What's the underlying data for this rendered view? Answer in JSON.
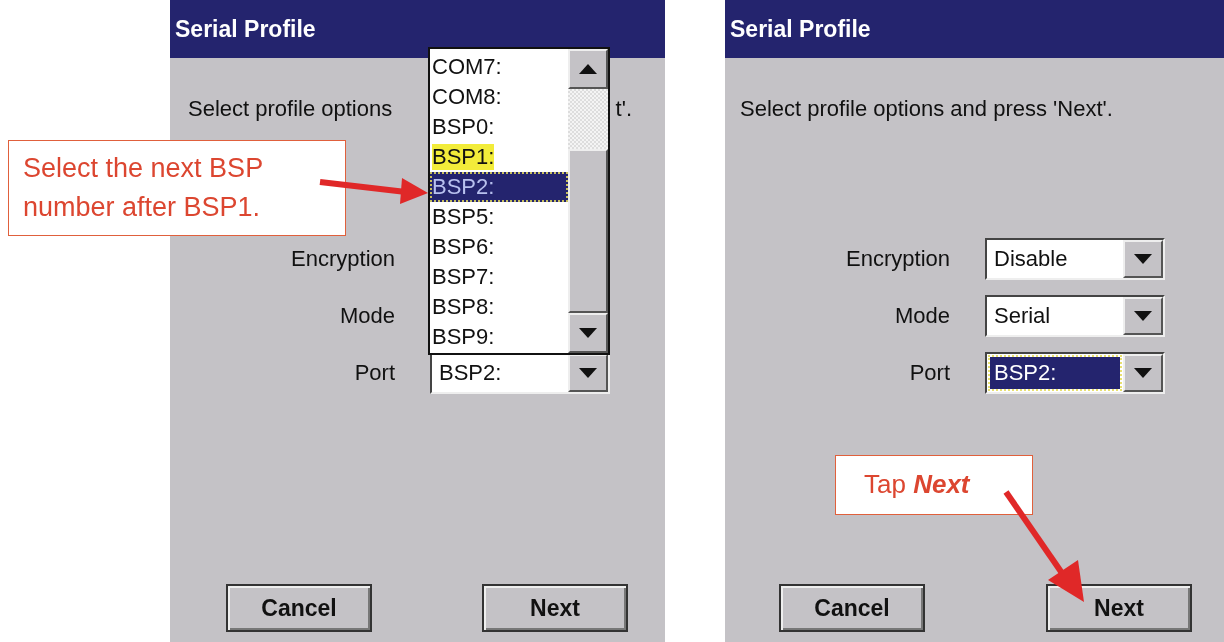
{
  "screens": [
    {
      "title": "Serial Profile",
      "instruction": [
        "Select profile options",
        "t'."
      ],
      "fields": [
        {
          "label": "Encryption"
        },
        {
          "label": "Mode"
        },
        {
          "label": "Port",
          "value": "BSP2:",
          "focused": false
        }
      ],
      "dropdown_list": {
        "items": [
          {
            "label": "COM7:",
            "selected": false,
            "highlighted": false
          },
          {
            "label": "COM8:",
            "selected": false,
            "highlighted": false
          },
          {
            "label": "BSP0:",
            "selected": false,
            "highlighted": false
          },
          {
            "label": "BSP1:",
            "selected": false,
            "highlighted": true
          },
          {
            "label": "BSP2:",
            "selected": true,
            "highlighted": false
          },
          {
            "label": "BSP5:",
            "selected": false,
            "highlighted": false
          },
          {
            "label": "BSP6:",
            "selected": false,
            "highlighted": false
          },
          {
            "label": "BSP7:",
            "selected": false,
            "highlighted": false
          },
          {
            "label": "BSP8:",
            "selected": false,
            "highlighted": false
          },
          {
            "label": "BSP9:",
            "selected": false,
            "highlighted": false
          }
        ]
      },
      "buttons": [
        "Cancel",
        "Next"
      ],
      "callout": {
        "kind": "side",
        "text": "Select the next BSP number after BSP1."
      }
    },
    {
      "title": "Serial Profile",
      "instruction": [
        "Select profile options and press 'Next'."
      ],
      "fields": [
        {
          "label": "Encryption",
          "value": "Disable",
          "focused": false
        },
        {
          "label": "Mode",
          "value": "Serial",
          "focused": false
        },
        {
          "label": "Port",
          "value": "BSP2:",
          "focused": true
        }
      ],
      "buttons": [
        "Cancel",
        "Next"
      ],
      "callout": {
        "kind": "below",
        "text": "Tap **Next**"
      }
    }
  ]
}
